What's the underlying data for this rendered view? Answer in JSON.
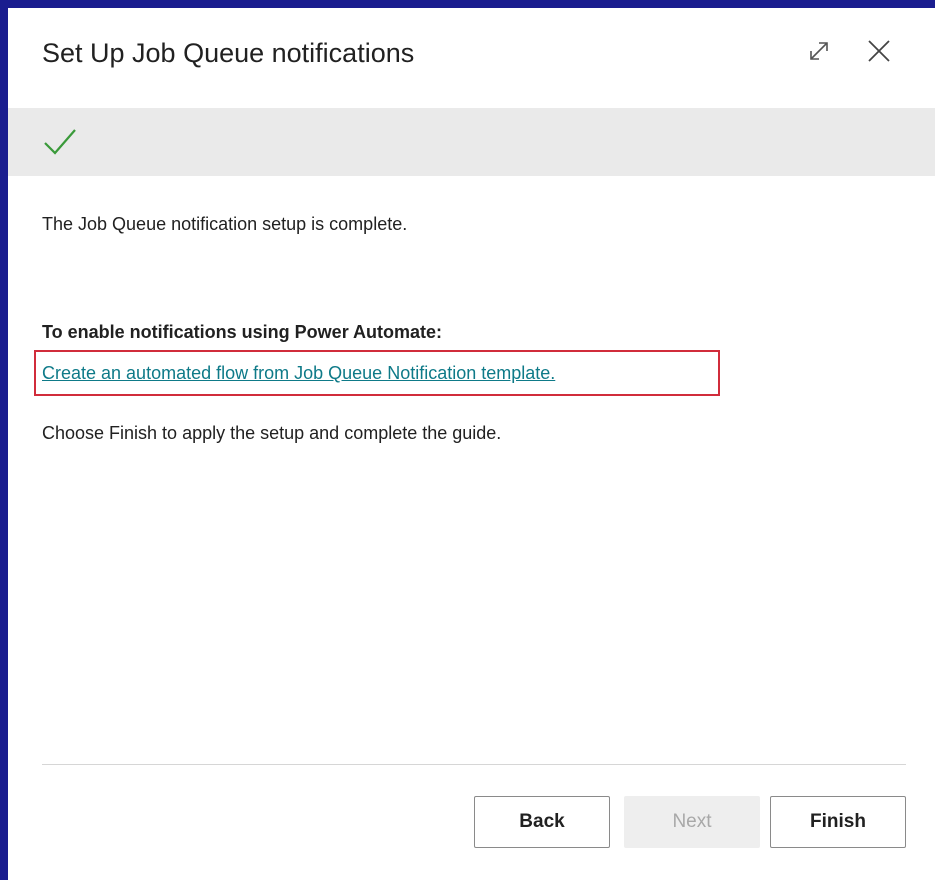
{
  "dialog": {
    "title": "Set Up Job Queue notifications",
    "icons": {
      "expand": "expand-icon",
      "close": "close-icon",
      "success": "checkmark-icon"
    },
    "status_text": "The Job Queue notification setup is complete.",
    "section_heading": "To enable notifications using Power Automate:",
    "flow_link": "Create an automated flow from Job Queue Notification template.",
    "finish_hint": "Choose Finish to apply the setup and complete the guide."
  },
  "buttons": {
    "back": "Back",
    "next": "Next",
    "finish": "Finish"
  },
  "colors": {
    "accent_check": "#3a9a3a",
    "link": "#0e7a88",
    "highlight_border": "#d12c3b",
    "frame_background": "#1a1d8f"
  }
}
